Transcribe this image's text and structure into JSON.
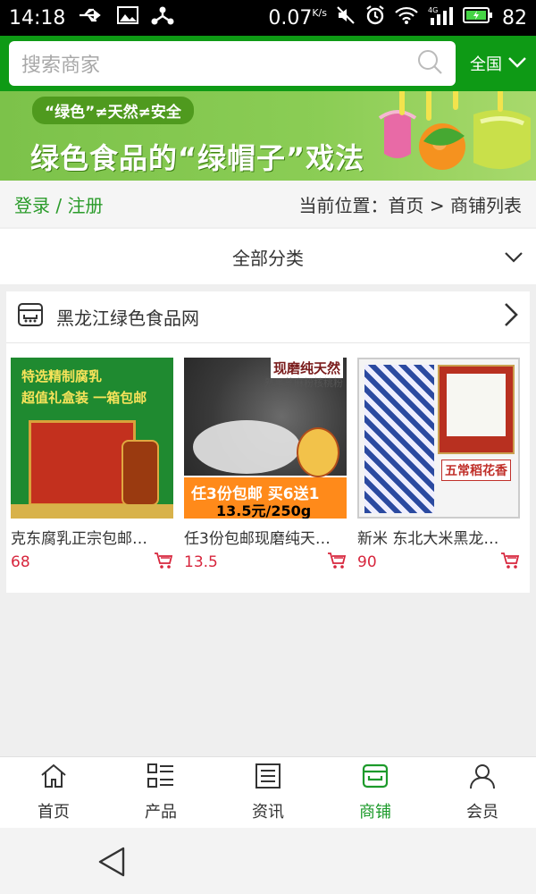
{
  "status_bar": {
    "time": "14:18",
    "speed": "0.07",
    "speed_unit": "K/s",
    "battery": "82",
    "network": "4G"
  },
  "header": {
    "search_placeholder": "搜索商家",
    "region": "全国"
  },
  "banner": {
    "pill": "“绿色”≠天然≠安全",
    "headline": "绿色食品的“绿帽子”戏法"
  },
  "breadcrumb": {
    "login": "登录 / 注册",
    "location": "当前位置：首页 > 商铺列表"
  },
  "category": {
    "label": "全部分类"
  },
  "shop": {
    "name": "黑龙江绿色食品网",
    "products": [
      {
        "title": "克东腐乳正宗包邮…",
        "price": "68",
        "img_text1": "特选精制腐乳",
        "img_text2": "超值礼盒装 一箱包邮"
      },
      {
        "title": "任3份包邮现磨纯天…",
        "price": "13.5",
        "img_text1": "现磨纯天然",
        "img_text2": "熟黑芝麻粉核桃粉",
        "img_promo": "任3份包邮 买6送1",
        "img_price": "13.5元/250g"
      },
      {
        "title": "新米 东北大米黑龙…",
        "price": "90",
        "img_label": "五常稻花香"
      }
    ]
  },
  "bottom_nav": [
    {
      "label": "首页",
      "icon": "home-icon"
    },
    {
      "label": "产品",
      "icon": "product-list-icon"
    },
    {
      "label": "资讯",
      "icon": "news-icon"
    },
    {
      "label": "商铺",
      "icon": "shop-icon",
      "active": true
    },
    {
      "label": "会员",
      "icon": "user-icon"
    }
  ],
  "colors": {
    "brand_green": "#0e9a15",
    "active_green": "#1c9a2a",
    "price_red": "#d7263d"
  }
}
